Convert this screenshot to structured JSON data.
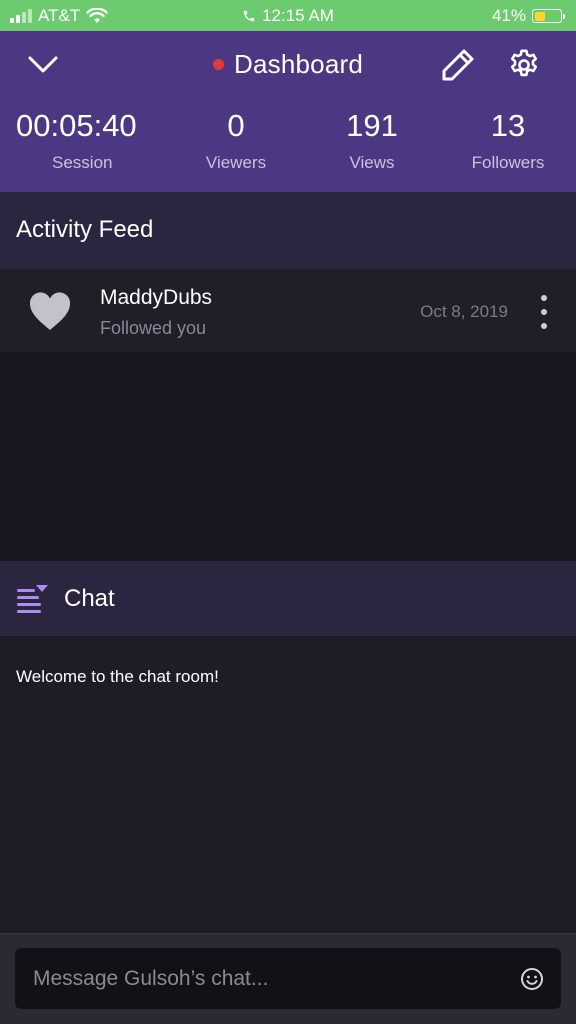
{
  "status_bar": {
    "carrier": "AT&T",
    "time": "12:15 AM",
    "battery": "41%",
    "battery_level": 0.41
  },
  "header": {
    "title": "Dashboard",
    "stats": [
      {
        "value": "00:05:40",
        "label": "Session"
      },
      {
        "value": "0",
        "label": "Viewers"
      },
      {
        "value": "191",
        "label": "Views"
      },
      {
        "value": "13",
        "label": "Followers"
      }
    ],
    "icons": [
      "chevron-down-icon",
      "pencil-icon",
      "gear-icon"
    ],
    "live_color": "#e23b3b",
    "background": "#4b3782"
  },
  "activity_feed": {
    "title": "Activity Feed",
    "items": [
      {
        "user": "MaddyDubs",
        "action": "Followed you",
        "date": "Oct 8, 2019",
        "icon": "heart-icon"
      }
    ]
  },
  "chat": {
    "title": "Chat",
    "messages": [
      "Welcome to the chat room!"
    ],
    "input_placeholder": "Message Gulsoh’s chat...",
    "accent": "#a98df0"
  }
}
